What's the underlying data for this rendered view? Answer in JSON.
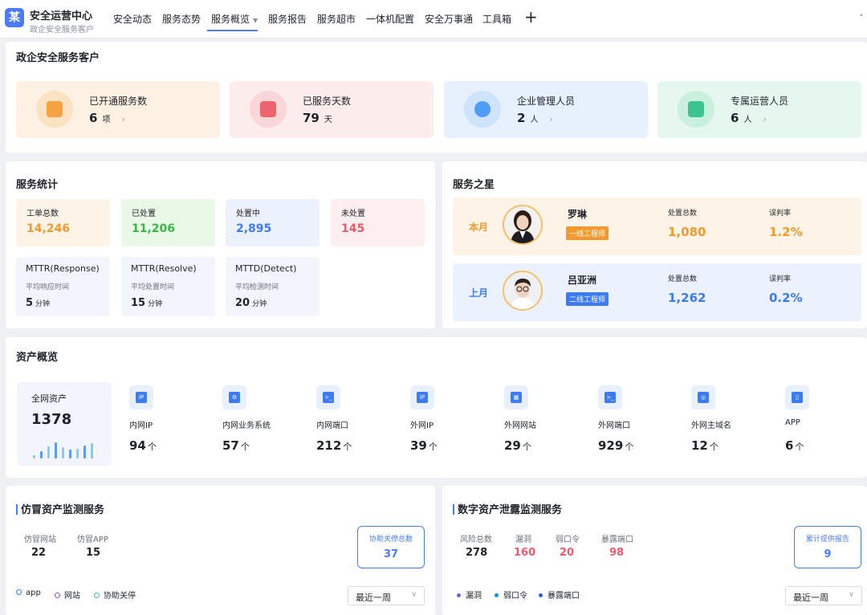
{
  "header": {
    "logo_char": "某",
    "title": "安全运营中心",
    "subtitle": "政企安全服务客户",
    "nav": [
      "安全动态",
      "服务态势",
      "服务概览",
      "服务报告",
      "服务超市",
      "一体机配置",
      "安全万事通",
      "工具箱"
    ],
    "active_nav": "服务概览",
    "plus": "+",
    "more": "·"
  },
  "summary": {
    "title": "政企安全服务客户",
    "cards": [
      {
        "label": "已开通服务数",
        "value": "6",
        "unit": "项",
        "arrow": "›",
        "color": "#f5a341"
      },
      {
        "label": "已服务天数",
        "value": "79",
        "unit": "天",
        "arrow": "",
        "color": "#ee6370"
      },
      {
        "label": "企业管理人员",
        "value": "2",
        "unit": "人",
        "arrow": "›",
        "color": "#4f9cf4"
      },
      {
        "label": "专属运营人员",
        "value": "6",
        "unit": "人",
        "arrow": "›",
        "color": "#3cc48e"
      }
    ]
  },
  "stats": {
    "title": "服务统计",
    "cards": [
      {
        "label": "工单总数",
        "value": "14,246",
        "color": "#f29a2e"
      },
      {
        "label": "已处置",
        "value": "11,206",
        "color": "#38b84a"
      },
      {
        "label": "处置中",
        "value": "2,895",
        "color": "#3d7bf0"
      },
      {
        "label": "未处置",
        "value": "145",
        "color": "#ef5a6a"
      }
    ],
    "metrics": [
      {
        "title": "MTTR(Response)",
        "sub": "平均响应时间",
        "value": "5",
        "unit": "分钟"
      },
      {
        "title": "MTTR(Resolve)",
        "sub": "平均处置时间",
        "value": "15",
        "unit": "分钟"
      },
      {
        "title": "MTTD(Detect)",
        "sub": "平均检测时间",
        "value": "20",
        "unit": "分钟"
      }
    ]
  },
  "stars": {
    "title": "服务之星",
    "handled_label": "处置总数",
    "misjudge_label": "误判率",
    "rows": [
      {
        "period": "本月",
        "name": "罗琳",
        "tag": "一线工程师",
        "handled": "1,080",
        "misjudge": "1.2%",
        "accent": "#f29a2e"
      },
      {
        "period": "上月",
        "name": "吕亚洲",
        "tag": "二线工程师",
        "handled": "1,262",
        "misjudge": "0.2%",
        "accent": "#3d7bf0"
      }
    ]
  },
  "assets": {
    "title": "资产概览",
    "total_label": "全网资产",
    "total": "1378",
    "mini_bars": [
      0.2,
      0.45,
      0.75,
      1.0,
      0.7,
      0.55,
      0.6,
      0.8,
      0.95
    ],
    "unit": "个",
    "items": [
      {
        "icon": "ip-icon",
        "glyph": "IP",
        "label": "内网IP",
        "value": "94"
      },
      {
        "icon": "gear-system-icon",
        "glyph": "⚙",
        "label": "内网业务系统",
        "value": "57"
      },
      {
        "icon": "terminal-port-icon",
        "glyph": ">_",
        "label": "内网端口",
        "value": "212"
      },
      {
        "icon": "ip-icon",
        "glyph": "IP",
        "label": "外网IP",
        "value": "39"
      },
      {
        "icon": "website-icon",
        "glyph": "▦",
        "label": "外网网站",
        "value": "29"
      },
      {
        "icon": "terminal-port-icon",
        "glyph": ">_",
        "label": "外网端口",
        "value": "929"
      },
      {
        "icon": "globe-icon",
        "glyph": "◎",
        "label": "外网主域名",
        "value": "12"
      },
      {
        "icon": "phone-icon",
        "glyph": "▯",
        "label": "APP",
        "value": "6"
      }
    ]
  },
  "counterfeit": {
    "title": "仿冒资产监测服务",
    "kpis": [
      {
        "label": "仿冒网站",
        "value": "22"
      },
      {
        "label": "仿冒APP",
        "value": "15"
      }
    ],
    "box": {
      "label": "协助关停总数",
      "value": "37"
    },
    "legend": [
      {
        "label": "app",
        "color": "#3d7bf0"
      },
      {
        "label": "网站",
        "color": "#7b5cf0"
      },
      {
        "label": "协助关停",
        "color": "#3cc48e"
      }
    ],
    "select": "最近一周"
  },
  "leak": {
    "title": "数字资产泄露监测服务",
    "kpis": [
      {
        "label": "风险总数",
        "value": "278",
        "color": "#1f2329"
      },
      {
        "label": "漏洞",
        "value": "160",
        "color": "#ef5a6a"
      },
      {
        "label": "弱口令",
        "value": "20",
        "color": "#ef5a6a"
      },
      {
        "label": "暴露端口",
        "value": "98",
        "color": "#ef5a6a"
      }
    ],
    "box": {
      "label": "累计提供报告",
      "value": "9"
    },
    "legend": [
      {
        "label": "漏洞",
        "color": "#7b5cf0"
      },
      {
        "label": "弱口令",
        "color": "#1f8fd8"
      },
      {
        "label": "暴露端口",
        "color": "#2f5fd8"
      }
    ],
    "select": "最近一周"
  }
}
